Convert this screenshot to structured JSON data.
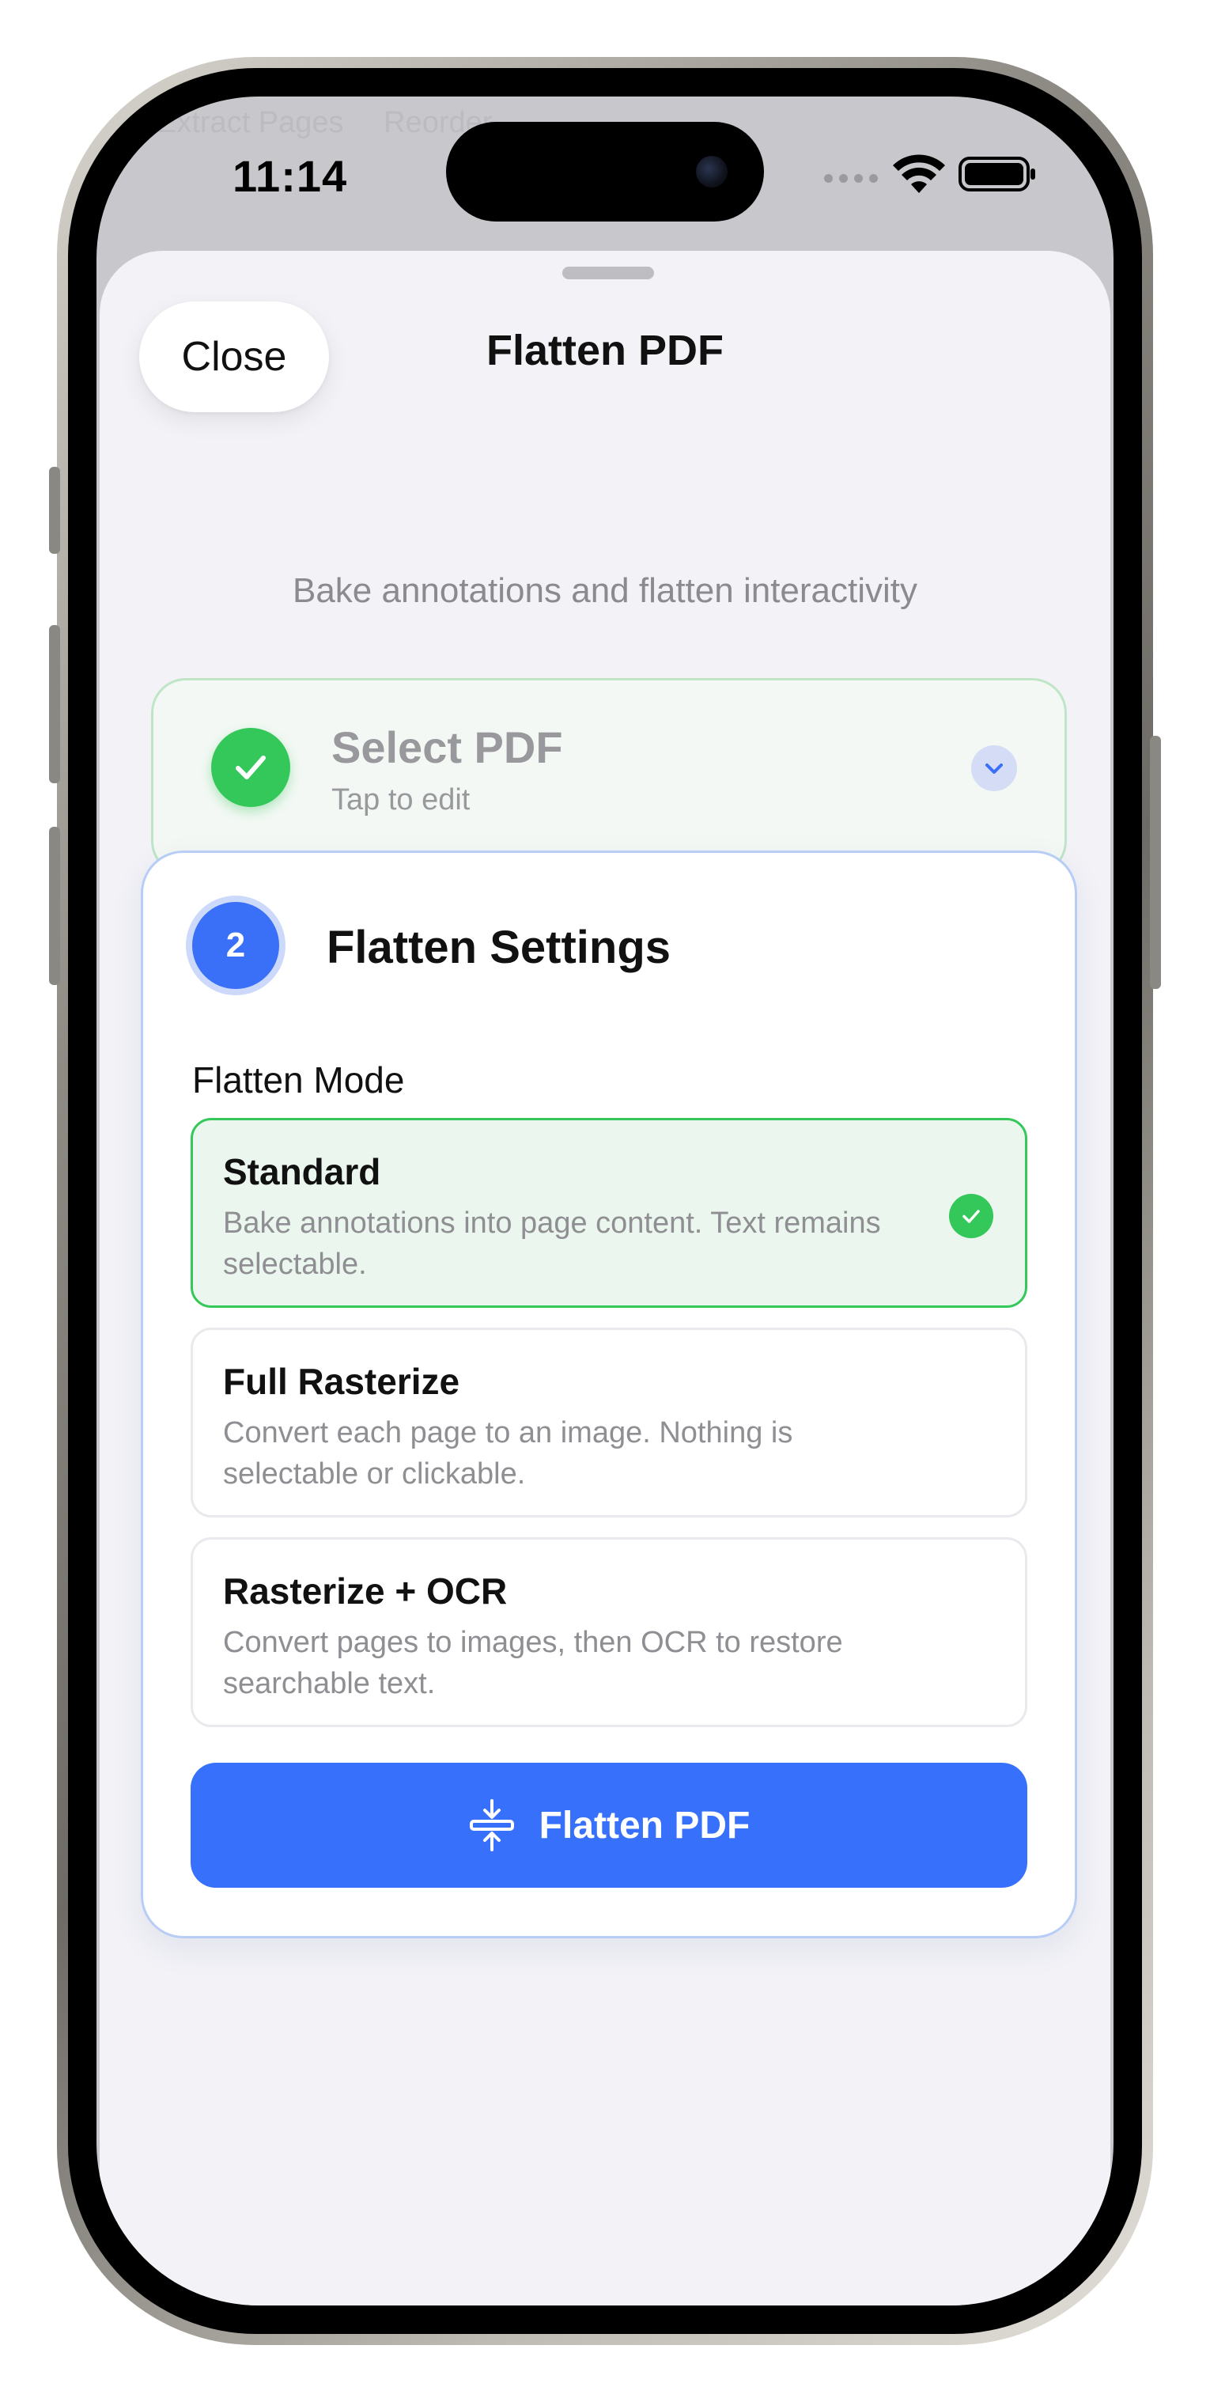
{
  "status_bar": {
    "time": "11:14",
    "icons": [
      "signal-dots-icon",
      "wifi-icon",
      "battery-icon"
    ]
  },
  "background_tabs": [
    "Extract Pages",
    "Reorder"
  ],
  "sheet": {
    "close_label": "Close",
    "title": "Flatten PDF",
    "subtitle": "Bake annotations and flatten interactivity"
  },
  "step1": {
    "title": "Select PDF",
    "subtitle": "Tap to edit",
    "state": "completed"
  },
  "step2": {
    "number": "2",
    "title": "Flatten Settings",
    "mode_label": "Flatten Mode",
    "options": [
      {
        "title": "Standard",
        "description": "Bake annotations into page content. Text remains selectable.",
        "selected": true
      },
      {
        "title": "Full Rasterize",
        "description": "Convert each page to an image. Nothing is selectable or clickable.",
        "selected": false
      },
      {
        "title": "Rasterize + OCR",
        "description": "Convert pages to images, then OCR to restore searchable text.",
        "selected": false
      }
    ],
    "action_label": "Flatten PDF",
    "action_icon": "flatten-compress-icon"
  },
  "colors": {
    "accent_blue": "#3770fa",
    "success_green": "#34c759",
    "sheet_background": "#f2f2f7",
    "selected_option_bg": "#ebf7ee"
  }
}
